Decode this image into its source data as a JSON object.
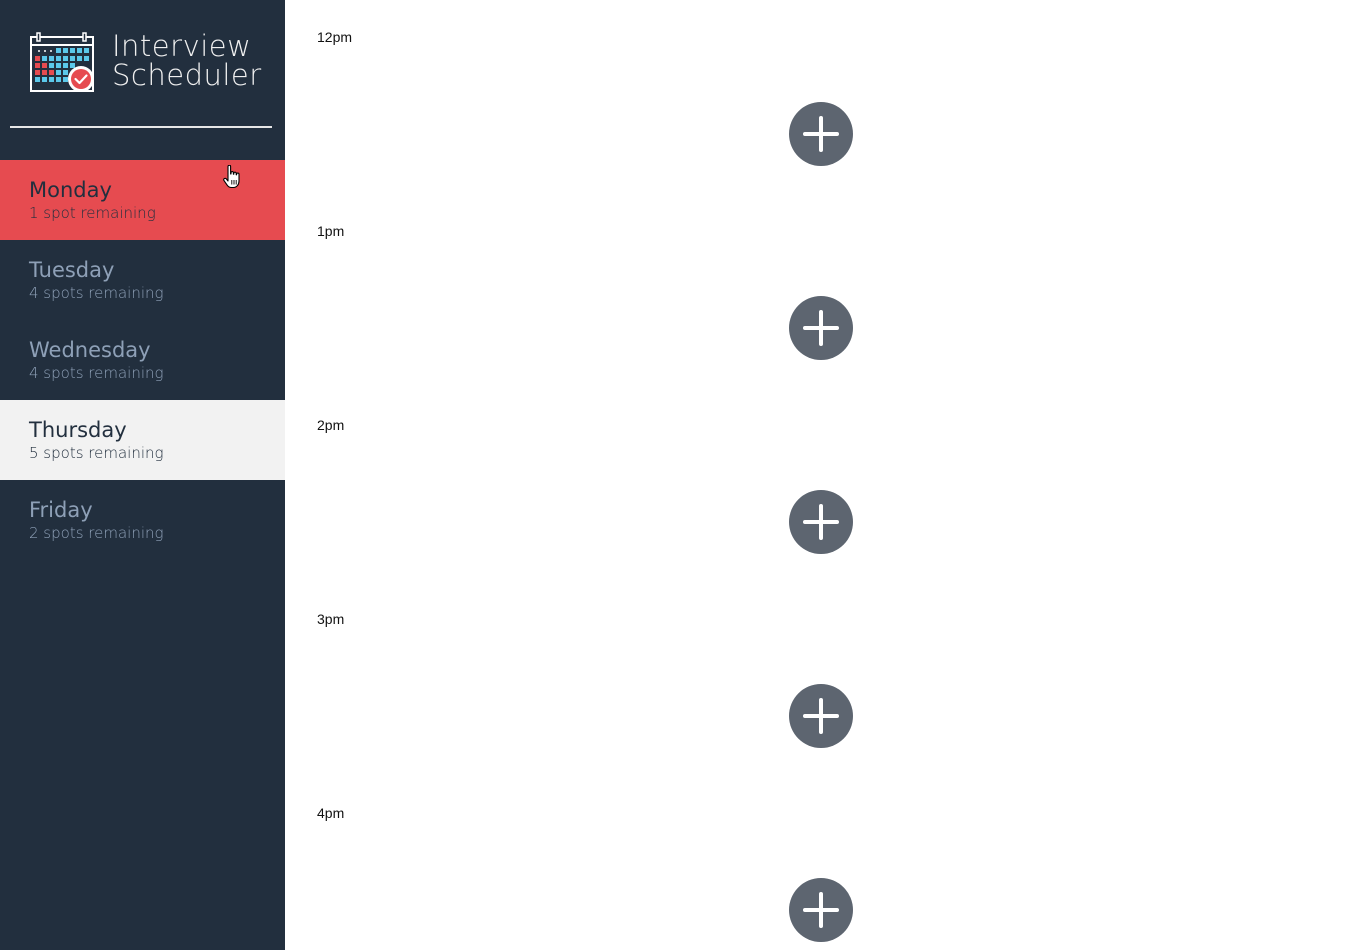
{
  "app": {
    "title_line1": "Interview",
    "title_line2": "Scheduler",
    "logo_icon": "calendar-check-icon"
  },
  "colors": {
    "sidebar_bg": "#222f3e",
    "hover_bg": "#e64b50",
    "selected_bg": "#f2f2f2",
    "muted_text": "#8ea0b7",
    "add_button_bg": "#5d6570"
  },
  "days": [
    {
      "name": "Monday",
      "spots": "1 spot remaining",
      "state": "hovered"
    },
    {
      "name": "Tuesday",
      "spots": "4 spots remaining",
      "state": "default"
    },
    {
      "name": "Wednesday",
      "spots": "4 spots remaining",
      "state": "default"
    },
    {
      "name": "Thursday",
      "spots": "5 spots remaining",
      "state": "selected"
    },
    {
      "name": "Friday",
      "spots": "2 spots remaining",
      "state": "default"
    }
  ],
  "appointments": [
    {
      "time": "12pm",
      "action_icon": "plus-icon"
    },
    {
      "time": "1pm",
      "action_icon": "plus-icon"
    },
    {
      "time": "2pm",
      "action_icon": "plus-icon"
    },
    {
      "time": "3pm",
      "action_icon": "plus-icon"
    },
    {
      "time": "4pm",
      "action_icon": "plus-icon"
    }
  ]
}
